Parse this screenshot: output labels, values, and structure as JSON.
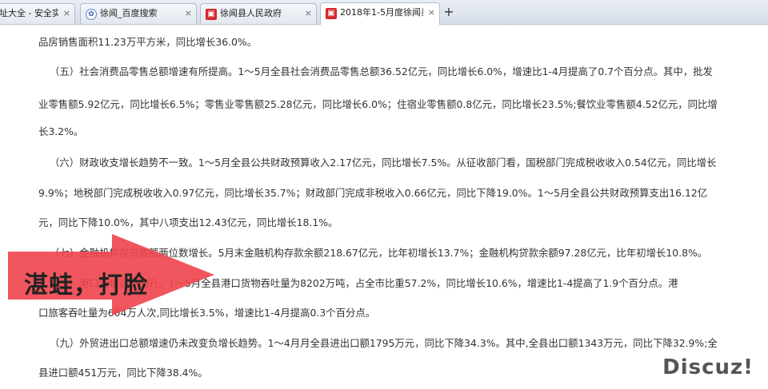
{
  "browser": {
    "tabs": [
      {
        "title": "址大全 - 安全实...",
        "favicon": "none",
        "active": false
      },
      {
        "title": "徐闻_百度搜索",
        "favicon": "globe-icon",
        "active": false
      },
      {
        "title": "徐闻县人民政府",
        "favicon": "red-page-icon",
        "active": false
      },
      {
        "title": "2018年1-5月度徐闻县...",
        "favicon": "red-page-icon",
        "active": true
      }
    ],
    "close_symbol": "×",
    "new_tab_symbol": "+"
  },
  "article": {
    "lines": [
      "品房销售面积11.23万平方米，同比增长36.0%。",
      "（五）社会消费品零售总额增速有所提高。1～5月全县社会消费品零售总额36.52亿元，同比增长6.0%，增速比1-4月提高了0.7个百分点。其中，批发",
      "业零售额5.92亿元，同比增长6.5%；零售业零售额25.28亿元，同比增长6.0%；住宿业零售额0.8亿元，同比增长23.5%;餐饮业零售额4.52亿元，同比增",
      "长3.2%。",
      "（六）财政收支增长趋势不一致。1～5月全县公共财政预算收入2.17亿元，同比增长7.5%。从征收部门看，国税部门完成税收收入0.54亿元，同比增长",
      "9.9%；地税部门完成税收收入0.97亿元，同比增长35.7%；财政部门完成非税收入0.66亿元，同比下降19.0%。1～5月全县公共财政预算支出16.12亿",
      "元，同比下降10.0%，其中八项支出12.43亿元，同比增长18.1%。",
      "（七）金融机构存贷款额两位数增长。5月末金融机构存款余额218.67亿元，比年初增长13.7%；金融机构贷款余额97.28亿元，比年初增长10.8%。",
      "（八）港口运输逐步回升。1～5月全县港口货物吞吐量为8202万吨，占全市比重57.2%，同比增长10.6%，增速比1-4提高了1.9个百分点。港",
      "口旅客吞吐量为604万人次,同比增长3.5%，增速比1-4月提高0.3个百分点。",
      "（九）外贸进出口总额增速仍未改变负增长趋势。1～4月月全县进出口额1795万元，同比下降34.3%。其中,全县出口额1343万元，同比下降32.9%;全",
      "县进口额451万元，同比下降38.4%。"
    ]
  },
  "overlay": {
    "text": "湛蛙，打脸",
    "arrow_color": "#f0444c"
  },
  "watermark": "Discuz!"
}
